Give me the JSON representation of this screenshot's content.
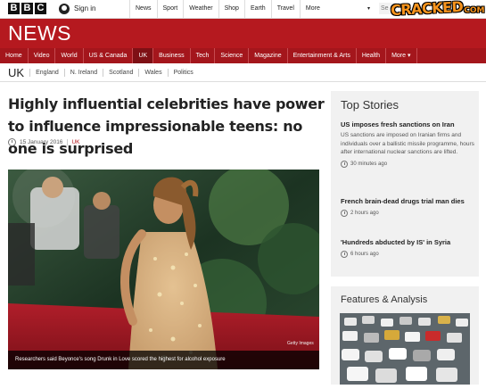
{
  "topbar": {
    "logo_letters": [
      "B",
      "B",
      "C"
    ],
    "signin": "Sign in",
    "nav": [
      "News",
      "Sport",
      "Weather",
      "Shop",
      "Earth",
      "Travel",
      "More"
    ],
    "search_placeholder": "Se",
    "cracked_logo": "CRACKED",
    "cracked_suffix": "COM"
  },
  "news": {
    "title": "NEWS",
    "nav": [
      "Home",
      "Video",
      "World",
      "US & Canada",
      "UK",
      "Business",
      "Tech",
      "Science",
      "Magazine",
      "Entertainment & Arts",
      "Health",
      "More ▾"
    ],
    "active": "UK"
  },
  "subnav": {
    "section": "UK",
    "items": [
      "England",
      "N. Ireland",
      "Scotland",
      "Wales",
      "Politics"
    ]
  },
  "article": {
    "headline": "Highly influential celebrities have power to influence impressionable teens: no one is surprised",
    "date": "15 January 2016",
    "category": "UK",
    "image_credit": "Getty Images",
    "caption": "Researchers said Beyonce's song Drunk in Love scored the highest for alcohol exposure"
  },
  "top_stories": {
    "heading": "Top Stories",
    "stories": [
      {
        "headline": "US imposes fresh sanctions on Iran",
        "summary": "US sanctions are imposed on Iranian firms and individuals over a ballistic missile programme, hours after international nuclear sanctions are lifted.",
        "time": "30 minutes ago"
      },
      {
        "headline": "French brain-dead drugs trial man dies",
        "time": "2 hours ago"
      },
      {
        "headline": "'Hundreds abducted by IS' in Syria",
        "time": "6 hours ago"
      }
    ]
  },
  "features": {
    "heading": "Features & Analysis"
  },
  "colors": {
    "news_red": "#b5191f",
    "nav_red": "#a4161c",
    "cracked_orange": "#f7941d"
  }
}
